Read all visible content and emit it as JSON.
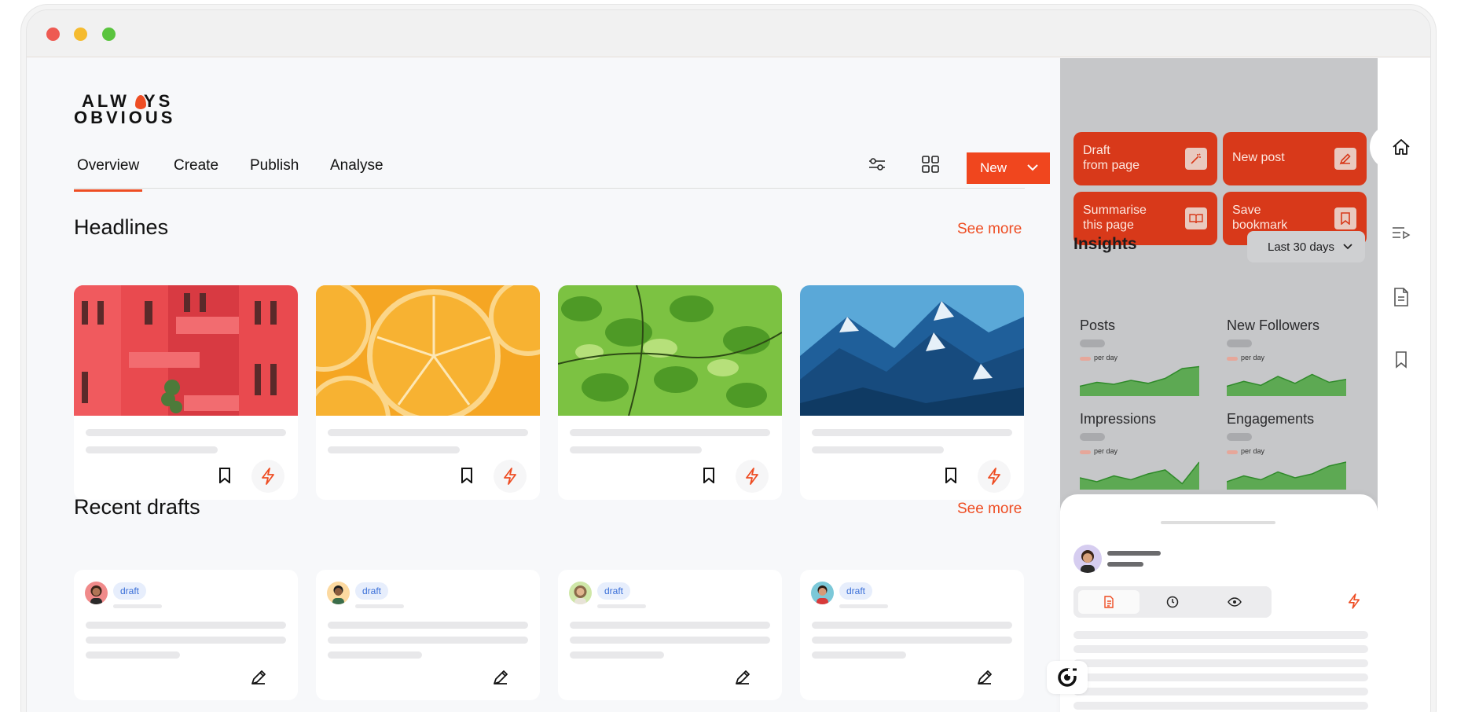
{
  "brand": {
    "line1": "ALW",
    "line1b": "YS",
    "line2": "OBVIOUS",
    "accent": "#ee4d23"
  },
  "nav": {
    "tabs": [
      {
        "label": "Overview",
        "active": true
      },
      {
        "label": "Create"
      },
      {
        "label": "Publish"
      },
      {
        "label": "Analyse"
      }
    ],
    "filter_icon": "sliders-icon",
    "grid_icon": "grid-icon",
    "new_label": "New"
  },
  "headlines": {
    "title": "Headlines",
    "see_more": "See more",
    "cards": [
      {
        "image": "red-building"
      },
      {
        "image": "orange-slices"
      },
      {
        "image": "green-leaves"
      },
      {
        "image": "blue-mountains"
      }
    ]
  },
  "drafts": {
    "title": "Recent drafts",
    "see_more": "See more",
    "items": [
      {
        "badge": "draft"
      },
      {
        "badge": "draft"
      },
      {
        "badge": "draft"
      },
      {
        "badge": "draft"
      }
    ]
  },
  "panel": {
    "actions": [
      {
        "label": "Draft from page",
        "line1": "Draft",
        "line2": "from page",
        "icon": "magic-wand-icon"
      },
      {
        "label": "New post",
        "line1": "New post",
        "line2": "",
        "icon": "pen-icon"
      },
      {
        "label": "Summarise this page",
        "line1": "Summarise",
        "line2": "this page",
        "icon": "book-icon"
      },
      {
        "label": "Save bookmark",
        "line1": "Save",
        "line2": "bookmark",
        "icon": "bookmark-icon"
      }
    ],
    "insights_title": "Insights",
    "range": "Last 30 days",
    "metrics": [
      {
        "name": "Posts",
        "per": "per day",
        "trend": [
          10,
          14,
          12,
          16,
          13,
          18,
          28,
          30
        ]
      },
      {
        "name": "New Followers",
        "per": "per day",
        "trend": [
          10,
          15,
          11,
          20,
          13,
          22,
          14,
          17
        ]
      },
      {
        "name": "Impressions",
        "per": "per day",
        "trend": [
          12,
          8,
          14,
          10,
          16,
          20,
          6,
          28
        ]
      },
      {
        "name": "Engagements",
        "per": "per day",
        "trend": [
          8,
          14,
          10,
          18,
          12,
          16,
          24,
          28
        ]
      }
    ]
  },
  "dock": {
    "icons": [
      "home-icon",
      "playlist-icon",
      "document-icon",
      "bookmark-icon"
    ]
  }
}
